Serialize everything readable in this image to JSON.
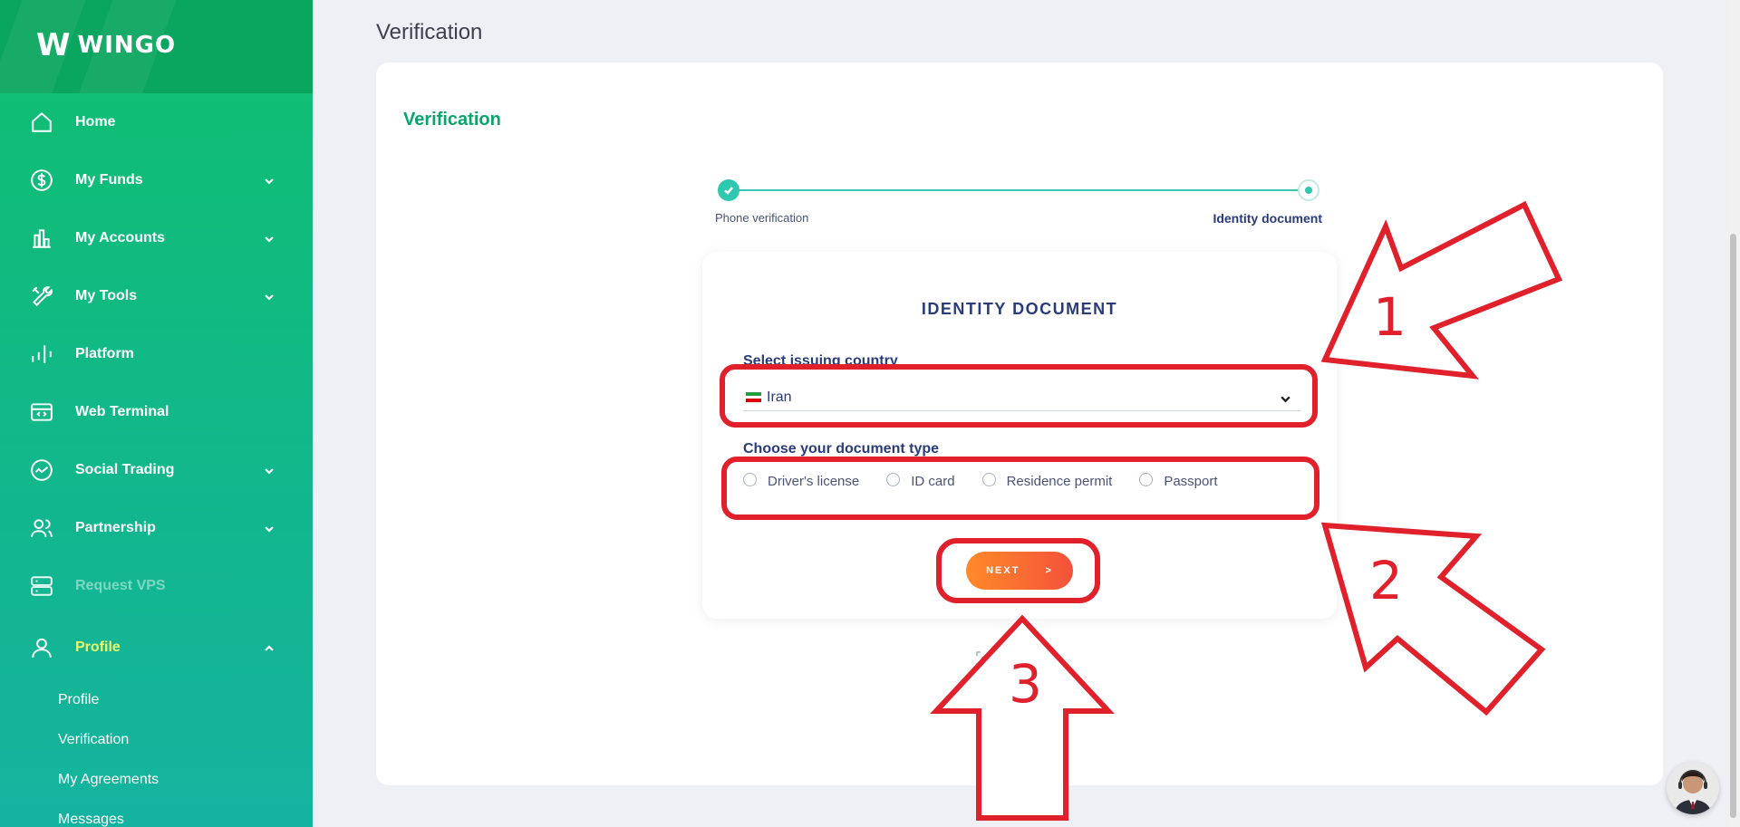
{
  "brand": {
    "name": "WINGO",
    "mark": "W"
  },
  "sidebar": {
    "items": [
      {
        "label": "Home",
        "icon": "home-icon",
        "chevron": false
      },
      {
        "label": "My Funds",
        "icon": "dollar-circle-icon",
        "chevron": true
      },
      {
        "label": "My Accounts",
        "icon": "bar-chart-icon",
        "chevron": true
      },
      {
        "label": "My Tools",
        "icon": "tools-icon",
        "chevron": true
      },
      {
        "label": "Platform",
        "icon": "signal-bars-icon",
        "chevron": false
      },
      {
        "label": "Web Terminal",
        "icon": "terminal-window-icon",
        "chevron": false
      },
      {
        "label": "Social Trading",
        "icon": "trend-circle-icon",
        "chevron": true
      },
      {
        "label": "Partnership",
        "icon": "users-icon",
        "chevron": true
      },
      {
        "label": "Request VPS",
        "icon": "server-icon",
        "chevron": false,
        "disabled": true
      },
      {
        "label": "Profile",
        "icon": "user-icon",
        "chevron": true,
        "active": true
      }
    ],
    "profile_sub": [
      "Profile",
      "Verification",
      "My Agreements",
      "Messages"
    ]
  },
  "page": {
    "title": "Verification"
  },
  "card": {
    "title": "Verification"
  },
  "stepper": {
    "step1": "Phone verification",
    "step2": "Identity document",
    "completed_steps": 1,
    "total_steps": 2
  },
  "identity": {
    "title": "IDENTITY DOCUMENT",
    "country_label": "Select issuing country",
    "country_value": "Iran",
    "doc_type_label": "Choose your document type",
    "doc_types": [
      "Driver's license",
      "ID card",
      "Residence permit",
      "Passport"
    ],
    "next_label": "NEXT",
    "next_arrow": ">"
  },
  "powered_by": "sumsub",
  "annotations": [
    "1",
    "2",
    "3"
  ],
  "colors": {
    "sidebar_green": "#0fbf6f",
    "accent_green": "#0aa56a",
    "navy": "#2a3b7a",
    "teal": "#2ec7b0",
    "orange": "#ff8a2a",
    "annotation_red": "#e0202a",
    "active_nav": "#e8ff70"
  }
}
